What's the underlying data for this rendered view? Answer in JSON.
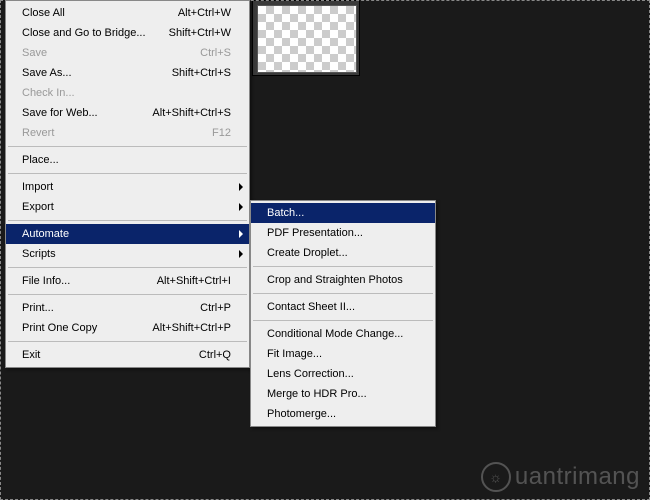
{
  "menu": {
    "items": [
      {
        "label": "Close All",
        "shortcut": "Alt+Ctrl+W",
        "disabled": false,
        "arrow": false
      },
      {
        "label": "Close and Go to Bridge...",
        "shortcut": "Shift+Ctrl+W",
        "disabled": false,
        "arrow": false
      },
      {
        "label": "Save",
        "shortcut": "Ctrl+S",
        "disabled": true,
        "arrow": false
      },
      {
        "label": "Save As...",
        "shortcut": "Shift+Ctrl+S",
        "disabled": false,
        "arrow": false
      },
      {
        "label": "Check In...",
        "shortcut": "",
        "disabled": true,
        "arrow": false
      },
      {
        "label": "Save for Web...",
        "shortcut": "Alt+Shift+Ctrl+S",
        "disabled": false,
        "arrow": false
      },
      {
        "label": "Revert",
        "shortcut": "F12",
        "disabled": true,
        "arrow": false
      },
      {
        "sep": true
      },
      {
        "label": "Place...",
        "shortcut": "",
        "disabled": false,
        "arrow": false
      },
      {
        "sep": true
      },
      {
        "label": "Import",
        "shortcut": "",
        "disabled": false,
        "arrow": true
      },
      {
        "label": "Export",
        "shortcut": "",
        "disabled": false,
        "arrow": true
      },
      {
        "sep": true
      },
      {
        "label": "Automate",
        "shortcut": "",
        "disabled": false,
        "arrow": true,
        "highlight": true
      },
      {
        "label": "Scripts",
        "shortcut": "",
        "disabled": false,
        "arrow": true
      },
      {
        "sep": true
      },
      {
        "label": "File Info...",
        "shortcut": "Alt+Shift+Ctrl+I",
        "disabled": false,
        "arrow": false
      },
      {
        "sep": true
      },
      {
        "label": "Print...",
        "shortcut": "Ctrl+P",
        "disabled": false,
        "arrow": false
      },
      {
        "label": "Print One Copy",
        "shortcut": "Alt+Shift+Ctrl+P",
        "disabled": false,
        "arrow": false
      },
      {
        "sep": true
      },
      {
        "label": "Exit",
        "shortcut": "Ctrl+Q",
        "disabled": false,
        "arrow": false
      }
    ]
  },
  "submenu": {
    "items": [
      {
        "label": "Batch...",
        "highlight": true
      },
      {
        "label": "PDF Presentation..."
      },
      {
        "label": "Create Droplet..."
      },
      {
        "sep": true
      },
      {
        "label": "Crop and Straighten Photos"
      },
      {
        "sep": true
      },
      {
        "label": "Contact Sheet II..."
      },
      {
        "sep": true
      },
      {
        "label": "Conditional Mode Change..."
      },
      {
        "label": "Fit Image..."
      },
      {
        "label": "Lens Correction..."
      },
      {
        "label": "Merge to HDR Pro..."
      },
      {
        "label": "Photomerge..."
      }
    ]
  },
  "watermark": {
    "text": "uantrimang"
  }
}
